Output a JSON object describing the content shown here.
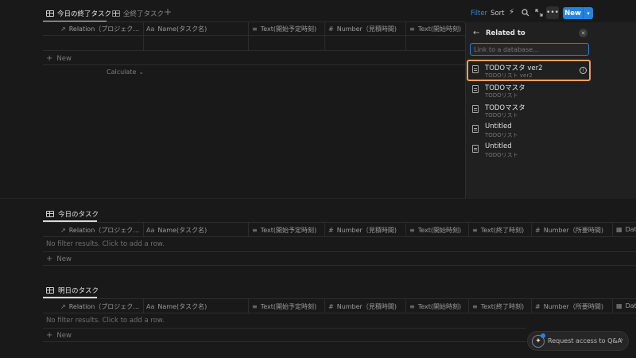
{
  "top_tabs": [
    {
      "label": "今日の終了タスク",
      "active": true
    },
    {
      "label": "全終了タスク",
      "active": false
    }
  ],
  "add_tab_symbol": "+",
  "toolbar": {
    "filter": "Filter",
    "sort": "Sort",
    "new": "New",
    "accent_color": "#2383e2"
  },
  "top_table": {
    "headers": [
      "Relation（プロジェク…",
      "Name(タスク名)",
      "Text(開始予定時刻)",
      "Number（見積時間)",
      "Text(開始時刻)"
    ],
    "header_icons": [
      "↗",
      "Aa",
      "≡",
      "#",
      "≡"
    ],
    "new_label": "New",
    "calculate_label": "Calculate"
  },
  "related_panel": {
    "title": "Related to",
    "search_placeholder": "Link to a database…",
    "items": [
      {
        "title": "TODOマスタ ver2",
        "subtitle": "TODOリスト ver2",
        "highlighted": true
      },
      {
        "title": "TODOマスタ",
        "subtitle": "TODOリスト"
      },
      {
        "title": "TODOマスタ",
        "subtitle": "TODOリスト"
      },
      {
        "title": "Untitled",
        "subtitle": "TODOリスト"
      },
      {
        "title": "Untitled",
        "subtitle": "TODOリスト"
      }
    ],
    "highlight_color": "#f0a35b"
  },
  "section_today": {
    "title": "今日のタスク",
    "headers": [
      "Relation（プロジェク…",
      "Name(タスク名)",
      "Text(開始予定時刻)",
      "Number（見積時間)",
      "Text(開始時刻)",
      "Text(終了時刻)",
      "Number（所要時間)",
      "Dat"
    ],
    "header_icons": [
      "↗",
      "Aa",
      "≡",
      "#",
      "≡",
      "≡",
      "#",
      "▦"
    ],
    "empty_text": "No filter results. Click to add a row.",
    "new_label": "New"
  },
  "section_tomorrow": {
    "title": "明日のタスク",
    "headers": [
      "Relation（プロジェク…",
      "Name(タスク名)",
      "Text(開始予定時刻)",
      "Number（見積時間)",
      "Text(開始時刻)",
      "Text(終了時刻)",
      "Number（所要時間)",
      "Dat"
    ],
    "header_icons": [
      "↗",
      "Aa",
      "≡",
      "#",
      "≡",
      "≡",
      "#",
      "▦"
    ],
    "empty_text": "No filter results. Click to add a row.",
    "new_label": "New"
  },
  "request_access": {
    "label": "Request access to Q&A"
  }
}
